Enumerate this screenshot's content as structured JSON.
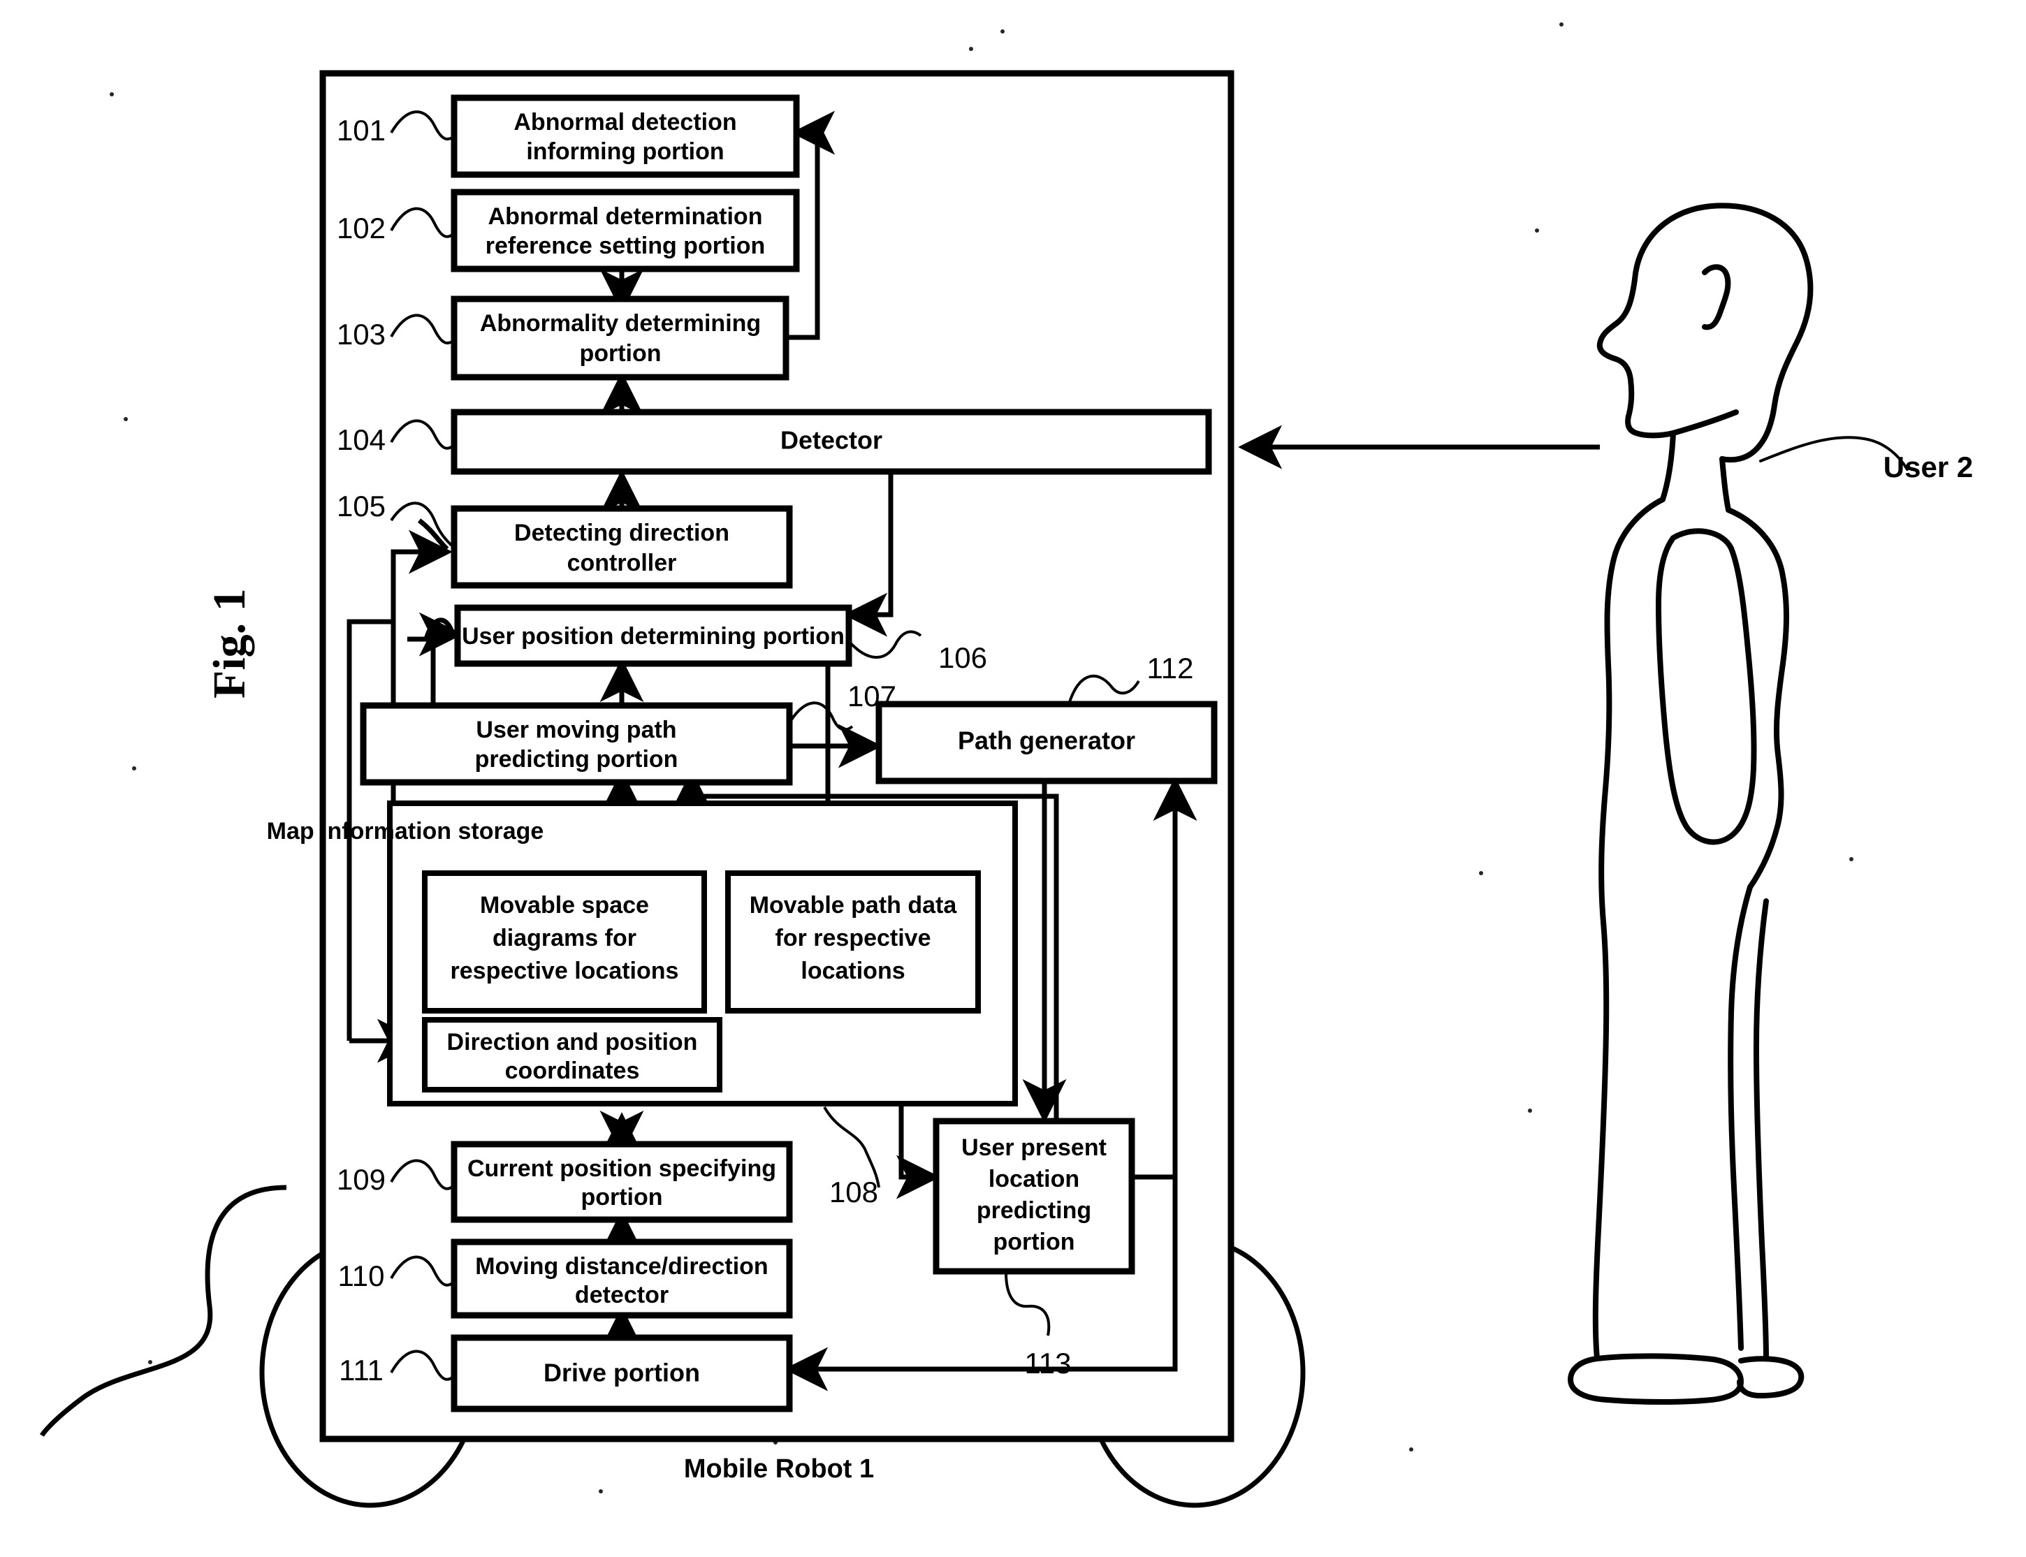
{
  "figure": {
    "title": "Fig. 1",
    "outer_label": "Mobile Robot 1",
    "user_label": "User 2"
  },
  "blocks": [
    {
      "id": "b101",
      "ref": "101",
      "lines": [
        "Abnormal detection",
        "informing portion"
      ]
    },
    {
      "id": "b102",
      "ref": "102",
      "lines": [
        "Abnormal determination",
        "reference setting portion"
      ]
    },
    {
      "id": "b103",
      "ref": "103",
      "lines": [
        "Abnormality determining",
        "portion"
      ]
    },
    {
      "id": "b104",
      "ref": "104",
      "lines": [
        "Detector"
      ]
    },
    {
      "id": "b105",
      "ref": "105",
      "lines": [
        "Detecting direction",
        "controller"
      ]
    },
    {
      "id": "b106",
      "ref": "106",
      "lines": [
        "User position determining portion"
      ]
    },
    {
      "id": "b107",
      "ref": "107",
      "lines": [
        "User moving path",
        "predicting portion"
      ]
    },
    {
      "id": "b112",
      "ref": "112",
      "lines": [
        "Path generator"
      ]
    },
    {
      "id": "b108",
      "ref": "108",
      "lines": [
        "Map information storage"
      ]
    },
    {
      "id": "b108a",
      "ref": "",
      "lines": [
        "Movable space",
        "diagrams for",
        "respective locations"
      ]
    },
    {
      "id": "b108b",
      "ref": "",
      "lines": [
        "Movable path data",
        "for respective",
        "locations"
      ]
    },
    {
      "id": "b108c",
      "ref": "",
      "lines": [
        "Direction and position",
        "coordinates"
      ]
    },
    {
      "id": "b109",
      "ref": "109",
      "lines": [
        "Current position specifying",
        "portion"
      ]
    },
    {
      "id": "b110",
      "ref": "110",
      "lines": [
        "Moving distance/direction",
        "detector"
      ]
    },
    {
      "id": "b111",
      "ref": "111",
      "lines": [
        "Drive portion"
      ]
    },
    {
      "id": "b113",
      "ref": "113",
      "lines": [
        "User present",
        "location",
        "predicting",
        "portion"
      ]
    }
  ],
  "colors": {
    "ink": "#000000",
    "paper": "#ffffff"
  }
}
